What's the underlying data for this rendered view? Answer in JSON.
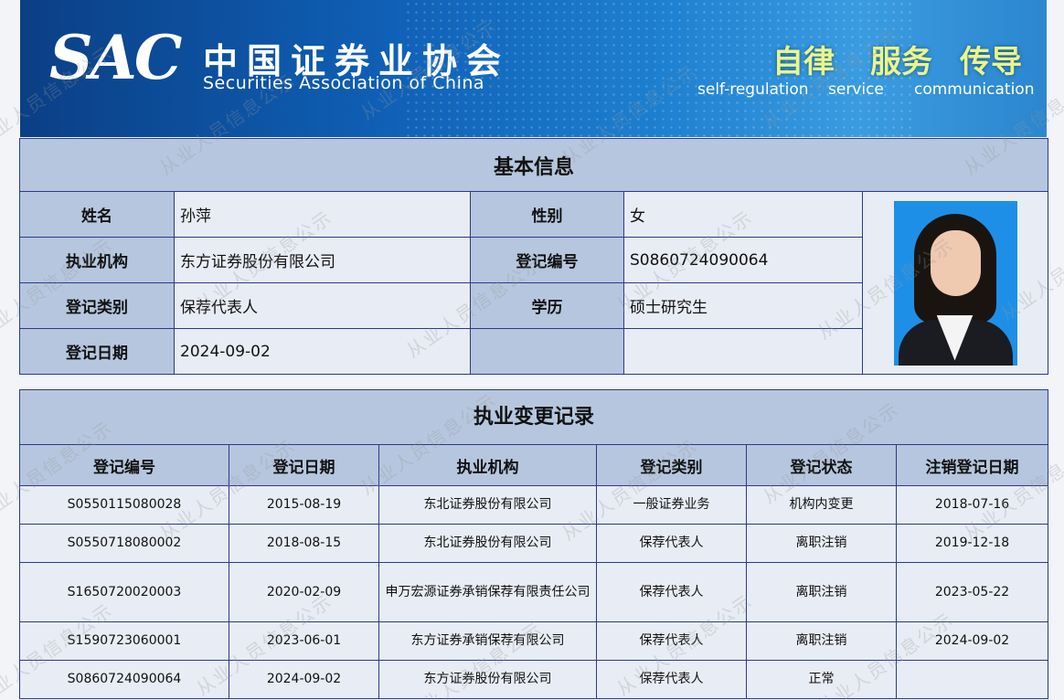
{
  "banner": {
    "logo": "SAC",
    "org_cn": "中国证券业协会",
    "org_en": "Securities Association of China",
    "motto_cn": [
      "自律",
      "服务",
      "传导"
    ],
    "motto_en": [
      "self-regulation",
      "service",
      "communication"
    ]
  },
  "basic": {
    "title": "基本信息",
    "name_label": "姓名",
    "name": "孙萍",
    "gender_label": "性别",
    "gender": "女",
    "org_label": "执业机构",
    "org": "东方证券股份有限公司",
    "regno_label": "登记编号",
    "regno": "S0860724090064",
    "category_label": "登记类别",
    "category": "保荐代表人",
    "edu_label": "学历",
    "edu": "硕士研究生",
    "date_label": "登记日期",
    "date": "2024-09-02"
  },
  "records": {
    "title": "执业变更记录",
    "headers": [
      "登记编号",
      "登记日期",
      "执业机构",
      "登记类别",
      "登记状态",
      "注销登记日期"
    ],
    "rows": [
      [
        "S0550115080028",
        "2015-08-19",
        "东北证券股份有限公司",
        "一般证券业务",
        "机构内变更",
        "2018-07-16"
      ],
      [
        "S0550718080002",
        "2018-08-15",
        "东北证券股份有限公司",
        "保荐代表人",
        "离职注销",
        "2019-12-18"
      ],
      [
        "S1650720020003",
        "2020-02-09",
        "申万宏源证券承销保荐有限责任公司",
        "保荐代表人",
        "离职注销",
        "2023-05-22"
      ],
      [
        "S1590723060001",
        "2023-06-01",
        "东方证券承销保荐有限公司",
        "保荐代表人",
        "离职注销",
        "2024-09-02"
      ],
      [
        "S0860724090064",
        "2024-09-02",
        "东方证券股份有限公司",
        "保荐代表人",
        "正常",
        ""
      ]
    ]
  },
  "watermark": "从业人员信息公示"
}
